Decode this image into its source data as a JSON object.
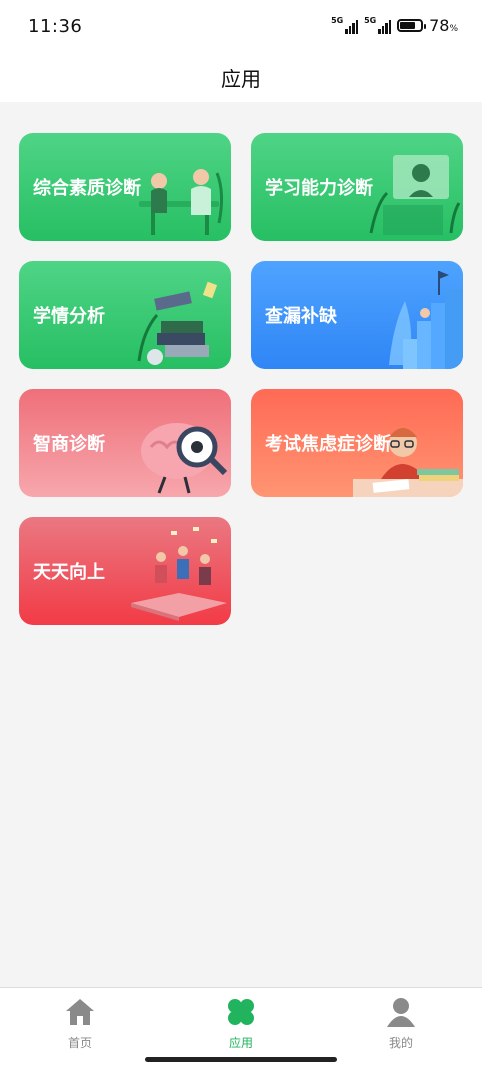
{
  "status_bar": {
    "time": "11:36",
    "signal_1_label": "5G",
    "signal_2_label": "5G",
    "battery_percent": "78",
    "battery_unit": "%"
  },
  "header": {
    "title": "应用"
  },
  "apps": [
    {
      "label": "综合素质诊断",
      "color": "#2ac467",
      "icon": "consultation-illustration"
    },
    {
      "label": "学习能力诊断",
      "color": "#2ac467",
      "icon": "video-learning-illustration"
    },
    {
      "label": "学情分析",
      "color": "#2ac467",
      "icon": "books-illustration"
    },
    {
      "label": "查漏补缺",
      "color": "#3a8ff7",
      "icon": "stairs-flag-illustration"
    },
    {
      "label": "智商诊断",
      "color": "#f38a92",
      "icon": "brain-magnifier-illustration"
    },
    {
      "label": "考试焦虑症诊断",
      "color": "#ff7a60",
      "icon": "student-exam-illustration"
    },
    {
      "label": "天天向上",
      "color": "#ef4a54",
      "icon": "open-book-people-illustration"
    }
  ],
  "tabbar": {
    "active_color": "#22b35e",
    "inactive_color": "#888888",
    "items": [
      {
        "label": "首页",
        "icon": "home-icon"
      },
      {
        "label": "应用",
        "icon": "clover-icon"
      },
      {
        "label": "我的",
        "icon": "person-icon"
      }
    ]
  }
}
